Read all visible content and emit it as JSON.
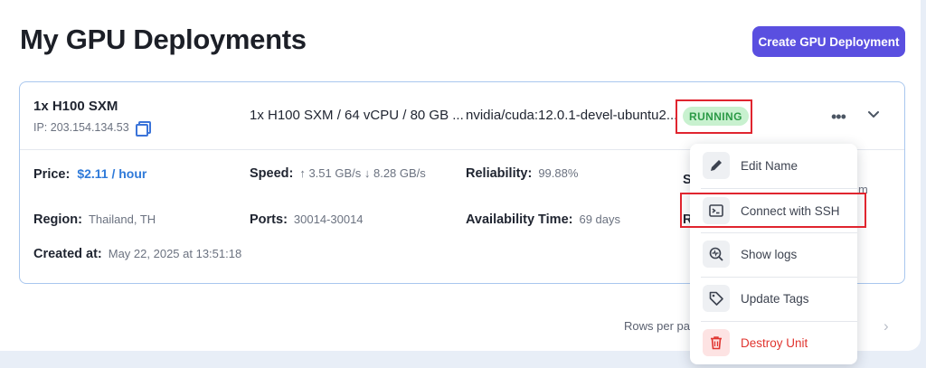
{
  "header": {
    "title": "My GPU Deployments",
    "create_button": "Create GPU Deployment"
  },
  "deployment": {
    "gpu_name": "1x H100 SXM",
    "ip": "IP: 203.154.134.53",
    "specs": "1x H100 SXM / 64 vCPU / 80 GB ...",
    "image": "nvidia/cuda:12.0.1-devel-ubuntu2...",
    "status": "RUNNING",
    "status_color": "#2b9a46",
    "details": {
      "price_label": "Price:",
      "price_value": "$2.11 / hour",
      "speed_label": "Speed:",
      "speed_value": "↑ 3.51 GB/s ↓ 8.28 GB/s",
      "reliability_label": "Reliability:",
      "reliability_value": "99.88%",
      "region_label": "Region:",
      "region_value": "Thailand, TH",
      "ports_label": "Ports:",
      "ports_value": "30014-30014",
      "availability_label": "Availability Time:",
      "availability_value": "69 days",
      "created_label": "Created at:",
      "created_value": "May 22, 2025 at 13:51:18",
      "partial_s": "S",
      "partial_r": "R",
      "partial_m": "m"
    }
  },
  "menu": {
    "items": [
      {
        "label": "Edit Name",
        "icon": "pencil-icon"
      },
      {
        "label": "Connect with SSH",
        "icon": "terminal-icon"
      },
      {
        "label": "Show logs",
        "icon": "logs-search-icon"
      },
      {
        "label": "Update Tags",
        "icon": "tag-icon"
      },
      {
        "label": "Destroy Unit",
        "icon": "trash-icon"
      }
    ]
  },
  "pagination": {
    "rows_per_page": "Rows per pa"
  },
  "colors": {
    "accent": "#5a4fe0",
    "highlight": "#e0252f",
    "link": "#2f7ad9",
    "danger": "#e0342f"
  }
}
